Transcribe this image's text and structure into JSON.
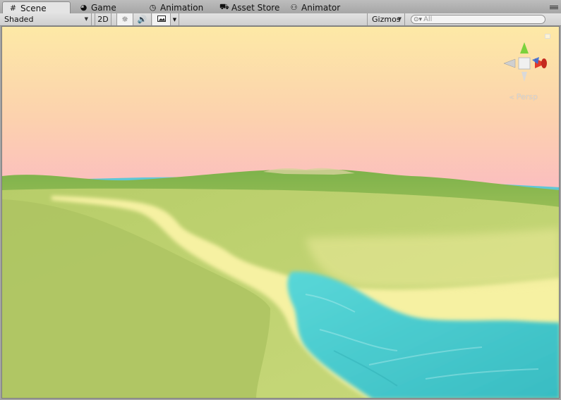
{
  "tabs": [
    {
      "label": "Scene",
      "icon": "grid-icon"
    },
    {
      "label": "Game",
      "icon": "pacman-icon"
    },
    {
      "label": "Animation",
      "icon": "clock-icon"
    },
    {
      "label": "Asset Store",
      "icon": "store-bag-icon"
    },
    {
      "label": "Animator",
      "icon": "nodes-icon"
    }
  ],
  "toolbar": {
    "shading_mode": "Shaded",
    "mode_2d_label": "2D",
    "gizmos_label": "Gizmos",
    "search_placeholder": "All"
  },
  "scene": {
    "projection_label": "Persp",
    "sky_top_color": "#fde9a6",
    "sky_horizon_color": "#fbbcc1",
    "grass_color": "#a9c55d",
    "sand_color": "#f6f1a2",
    "water_color": "#47c9cc"
  }
}
